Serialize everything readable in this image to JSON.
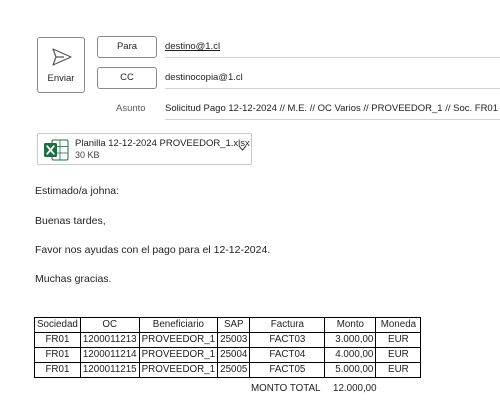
{
  "toolbar": {
    "send_label": "Enviar"
  },
  "header": {
    "to_label": "Para",
    "to_value": "destino@1.cl",
    "cc_label": "CC",
    "cc_value": "destinocopia@1.cl",
    "subject_label": "Asunto",
    "subject_value": "Solicitud Pago 12-12-2024 // M.E. // OC Varios // PROVEEDOR_1 // Soc. FR01"
  },
  "attachment": {
    "name": "Planilla 12-12-2024 PROVEEDOR_1.xlsx",
    "size": "30 KB",
    "icon": "excel-icon"
  },
  "body": {
    "greeting": "Estimado/a johna:",
    "line1": "Buenas tardes,",
    "line2": "Favor nos ayudas con el pago para el 12-12-2024.",
    "closing": "Muchas gracias."
  },
  "table": {
    "headers": [
      "Sociedad",
      "OC",
      "Beneficiario",
      "SAP",
      "Factura",
      "Monto",
      "Moneda"
    ],
    "rows": [
      [
        "FR01",
        "1200011213",
        "PROVEEDOR_1",
        "25003",
        "FACT03",
        "3.000,00",
        "EUR"
      ],
      [
        "FR01",
        "1200011214",
        "PROVEEDOR_1",
        "25004",
        "FACT04",
        "4.000,00",
        "EUR"
      ],
      [
        "FR01",
        "1200011215",
        "PROVEEDOR_1",
        "25005",
        "FACT05",
        "5.000,00",
        "EUR"
      ]
    ],
    "total_label": "MONTO TOTAL",
    "total_value": "12.000,00"
  },
  "colors": {
    "excel_green": "#1d6f42",
    "border_gray": "#8a8a8a"
  }
}
